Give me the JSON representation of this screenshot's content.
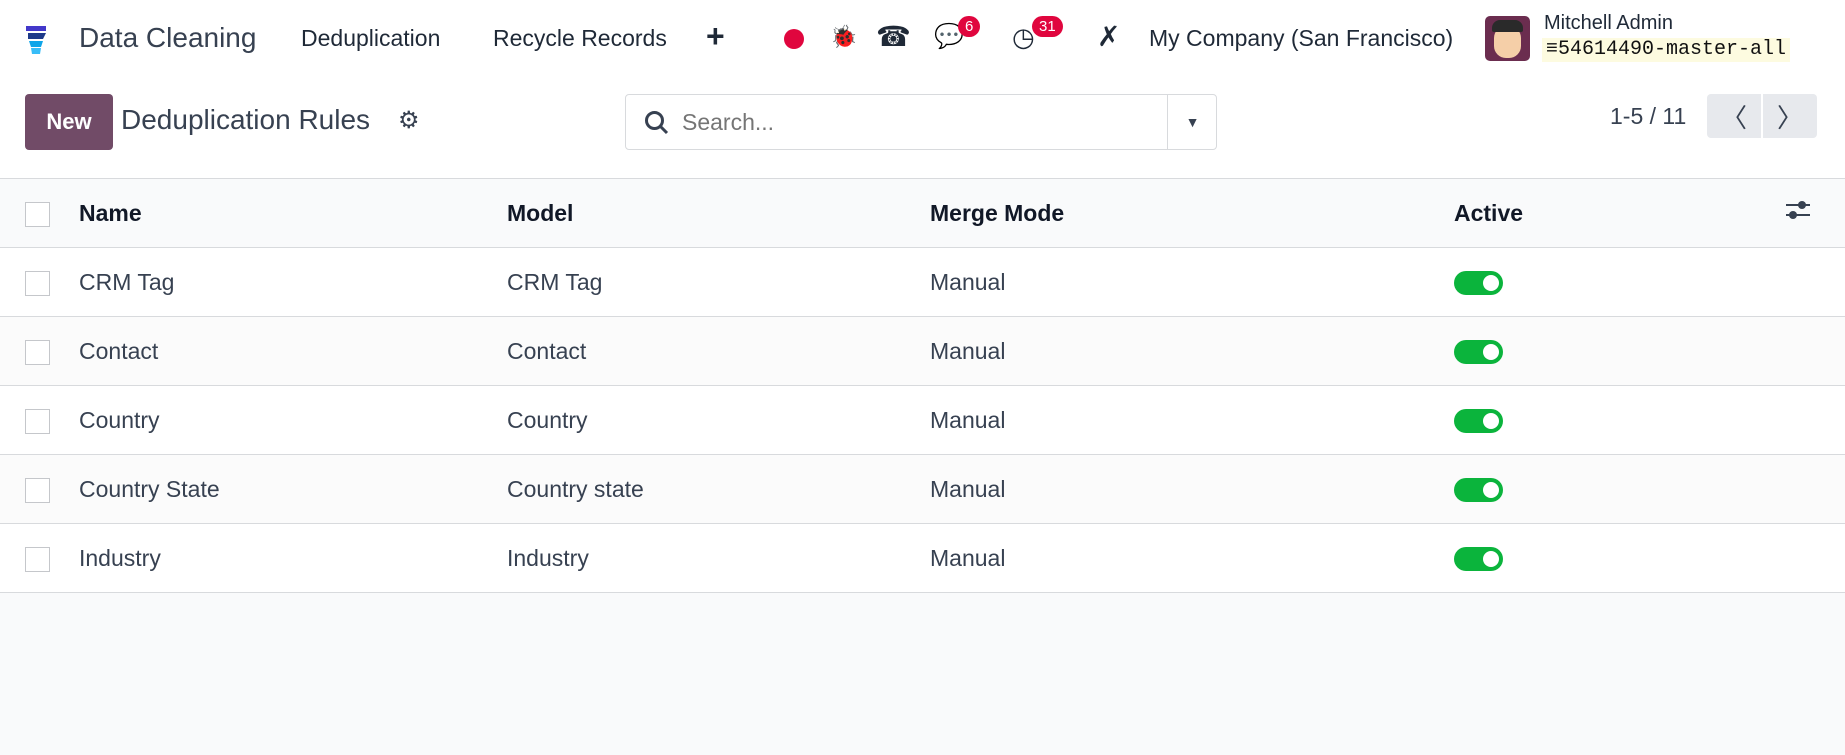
{
  "navbar": {
    "app_name": "Data Cleaning",
    "menus": [
      "Deduplication",
      "Recycle Records"
    ],
    "messages_count": "6",
    "activities_count": "31",
    "company": "My Company (San Francisco)",
    "user_name": "Mitchell Admin",
    "database": "54614490-master-all"
  },
  "control_panel": {
    "new_label": "New",
    "title": "Deduplication Rules",
    "search_placeholder": "Search...",
    "pager": "1-5 / 11"
  },
  "table": {
    "columns": [
      "Name",
      "Model",
      "Merge Mode",
      "Active"
    ],
    "rows": [
      {
        "name": "CRM Tag",
        "model": "CRM Tag",
        "merge_mode": "Manual",
        "active": true
      },
      {
        "name": "Contact",
        "model": "Contact",
        "merge_mode": "Manual",
        "active": true
      },
      {
        "name": "Country",
        "model": "Country",
        "merge_mode": "Manual",
        "active": true
      },
      {
        "name": "Country State",
        "model": "Country state",
        "merge_mode": "Manual",
        "active": true
      },
      {
        "name": "Industry",
        "model": "Industry",
        "merge_mode": "Manual",
        "active": true
      }
    ]
  },
  "colors": {
    "brand": "#714b67",
    "toggle_on": "#0bb43c",
    "badge": "#e0063e"
  }
}
